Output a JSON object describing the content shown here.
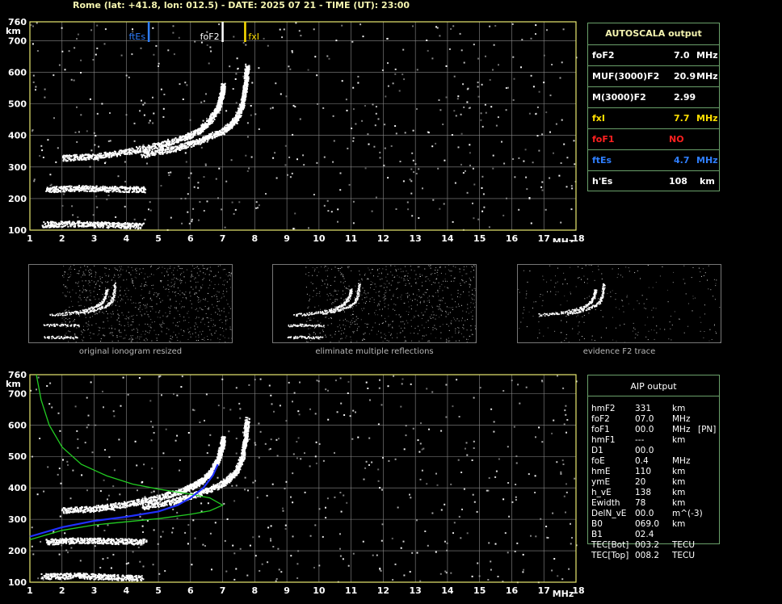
{
  "header": {
    "title": "Rome (lat: +41.8, lon: 012.5) - DATE: 2025 07 21 - TIME (UT): 23:00"
  },
  "colors": {
    "axis": "#e8e870",
    "grid": "#8a8a8a",
    "trace": "#ffffff",
    "ftEs": "#2f7fff",
    "foF2": "#ffffff",
    "fxI": "#ffe000",
    "foF1": "#ff2020",
    "profile_green": "#22cc22",
    "profile_blue": "#2030ff"
  },
  "chart_data": [
    {
      "type": "scatter",
      "xlabel": "MHz",
      "ylabel": "km",
      "xlim": [
        1,
        18
      ],
      "ylim": [
        100,
        760
      ],
      "x_ticks": [
        "1",
        "2",
        "3",
        "4",
        "5",
        "6",
        "7",
        "8",
        "9",
        "10",
        "11",
        "12",
        "13",
        "14",
        "15",
        "16",
        "17",
        "18"
      ],
      "y_ticks": [
        "100",
        "200",
        "300",
        "400",
        "500",
        "600",
        "700",
        "760"
      ],
      "grid": true,
      "markers": [
        {
          "label": "ftEs",
          "x": 4.7
        },
        {
          "label": "foF2",
          "x": 7.0
        },
        {
          "label": "fxI",
          "x": 7.7
        }
      ],
      "traces": [
        {
          "name": "F2 o-trace",
          "points": [
            [
              2.0,
              330
            ],
            [
              3.0,
              335
            ],
            [
              4.0,
              350
            ],
            [
              5.0,
              370
            ],
            [
              5.8,
              395
            ],
            [
              6.3,
              420
            ],
            [
              6.6,
              450
            ],
            [
              6.85,
              490
            ],
            [
              6.98,
              540
            ],
            [
              7.0,
              560
            ]
          ]
        },
        {
          "name": "F2 x-trace",
          "points": [
            [
              4.5,
              340
            ],
            [
              5.5,
              360
            ],
            [
              6.3,
              385
            ],
            [
              7.0,
              415
            ],
            [
              7.4,
              450
            ],
            [
              7.6,
              500
            ],
            [
              7.7,
              560
            ],
            [
              7.75,
              620
            ]
          ]
        },
        {
          "name": "Es trace",
          "points": [
            [
              1.5,
              230
            ],
            [
              2.5,
              235
            ],
            [
              3.5,
              232
            ],
            [
              4.6,
              230
            ]
          ]
        },
        {
          "name": "E echo",
          "points": [
            [
              1.4,
              120
            ],
            [
              2.5,
              122
            ],
            [
              3.5,
              118
            ],
            [
              4.5,
              115
            ]
          ]
        }
      ]
    },
    {
      "type": "line",
      "xlabel": "MHz",
      "ylabel": "km",
      "xlim": [
        1,
        18
      ],
      "ylim": [
        100,
        760
      ],
      "x_ticks": [
        "1",
        "2",
        "3",
        "4",
        "5",
        "6",
        "7",
        "8",
        "9",
        "10",
        "11",
        "12",
        "13",
        "14",
        "15",
        "16",
        "17",
        "18"
      ],
      "y_ticks": [
        "100",
        "200",
        "300",
        "400",
        "500",
        "600",
        "700",
        "760"
      ],
      "grid": true,
      "series": [
        {
          "name": "electron density profile",
          "points": [
            [
              1.0,
              235
            ],
            [
              2.0,
              265
            ],
            [
              3.0,
              282
            ],
            [
              4.0,
              292
            ],
            [
              5.0,
              302
            ],
            [
              6.0,
              316
            ],
            [
              6.6,
              327
            ],
            [
              7.0,
              345
            ],
            [
              6.6,
              368
            ],
            [
              6.0,
              380
            ],
            [
              5.0,
              396
            ],
            [
              4.2,
              412
            ],
            [
              3.4,
              438
            ],
            [
              2.6,
              475
            ],
            [
              2.0,
              530
            ],
            [
              1.6,
              600
            ],
            [
              1.35,
              680
            ],
            [
              1.2,
              760
            ]
          ]
        },
        {
          "name": "model virtual height",
          "points": [
            [
              1.0,
              245
            ],
            [
              2.0,
              275
            ],
            [
              3.0,
              295
            ],
            [
              4.0,
              308
            ],
            [
              5.0,
              325
            ],
            [
              5.6,
              345
            ],
            [
              6.0,
              368
            ],
            [
              6.4,
              400
            ],
            [
              6.7,
              440
            ],
            [
              6.85,
              475
            ]
          ]
        }
      ],
      "traces": [
        {
          "name": "F2 o-trace",
          "points": [
            [
              2.0,
              330
            ],
            [
              3.0,
              335
            ],
            [
              4.0,
              350
            ],
            [
              5.0,
              370
            ],
            [
              5.8,
              395
            ],
            [
              6.3,
              420
            ],
            [
              6.6,
              450
            ],
            [
              6.85,
              490
            ],
            [
              6.98,
              540
            ],
            [
              7.0,
              560
            ]
          ]
        },
        {
          "name": "F2 x-trace",
          "points": [
            [
              4.5,
              340
            ],
            [
              5.5,
              360
            ],
            [
              6.3,
              385
            ],
            [
              7.0,
              415
            ],
            [
              7.4,
              450
            ],
            [
              7.6,
              500
            ],
            [
              7.7,
              560
            ],
            [
              7.75,
              620
            ]
          ]
        },
        {
          "name": "Es trace",
          "points": [
            [
              1.5,
              230
            ],
            [
              2.5,
              235
            ],
            [
              3.5,
              232
            ],
            [
              4.6,
              230
            ]
          ]
        },
        {
          "name": "E echo",
          "points": [
            [
              1.4,
              120
            ],
            [
              2.5,
              122
            ],
            [
              3.5,
              118
            ],
            [
              4.5,
              115
            ]
          ]
        }
      ]
    }
  ],
  "autoscala": {
    "title": "AUTOSCALA output",
    "rows": [
      {
        "label": "foF2",
        "value": "7.0",
        "unit": "MHz",
        "color": "#ffffff"
      },
      {
        "label": "MUF(3000)F2",
        "value": "20.9",
        "unit": "MHz",
        "color": "#ffffff"
      },
      {
        "label": "M(3000)F2",
        "value": "2.99",
        "unit": "",
        "color": "#ffffff"
      },
      {
        "label": "fxI",
        "value": "7.7",
        "unit": "MHz",
        "color": "#ffe000"
      },
      {
        "label": "foF1",
        "value": "NO",
        "unit": "",
        "color": "#ff2020"
      },
      {
        "label": "ftEs",
        "value": "4.7",
        "unit": "MHz",
        "color": "#2f7fff"
      },
      {
        "label": "h'Es",
        "value": "108",
        "unit": "km",
        "color": "#ffffff"
      }
    ]
  },
  "aip": {
    "title": "AIP output",
    "rows": [
      {
        "label": "hmF2",
        "value": "331",
        "unit": "km",
        "extra": ""
      },
      {
        "label": "foF2",
        "value": "07.0",
        "unit": "MHz",
        "extra": ""
      },
      {
        "label": "foF1",
        "value": "00.0",
        "unit": "MHz",
        "extra": "[PN]"
      },
      {
        "label": "hmF1",
        "value": "---",
        "unit": "km",
        "extra": ""
      },
      {
        "label": "D1",
        "value": "00.0",
        "unit": "",
        "extra": ""
      },
      {
        "label": "foE",
        "value": "0.4",
        "unit": "MHz",
        "extra": ""
      },
      {
        "label": "hmE",
        "value": "110",
        "unit": "km",
        "extra": ""
      },
      {
        "label": "ymE",
        "value": "20",
        "unit": "km",
        "extra": ""
      },
      {
        "label": "h_vE",
        "value": "138",
        "unit": "km",
        "extra": ""
      },
      {
        "label": "Ewidth",
        "value": "78",
        "unit": "km",
        "extra": ""
      },
      {
        "label": "DelN_vE",
        "value": "00.0",
        "unit": "m^(-3)",
        "extra": ""
      },
      {
        "label": "B0",
        "value": "069.0",
        "unit": "km",
        "extra": ""
      },
      {
        "label": "B1",
        "value": "02.4",
        "unit": "",
        "extra": ""
      },
      {
        "label": "TEC[Bot]",
        "value": "003.2",
        "unit": "TECU",
        "extra": ""
      },
      {
        "label": "TEC[Top]",
        "value": "008.2",
        "unit": "TECU",
        "extra": ""
      }
    ]
  },
  "thumbnails": [
    {
      "caption": "original ionogram resized"
    },
    {
      "caption": "eliminate multiple reflections"
    },
    {
      "caption": "evidence F2 trace"
    }
  ]
}
